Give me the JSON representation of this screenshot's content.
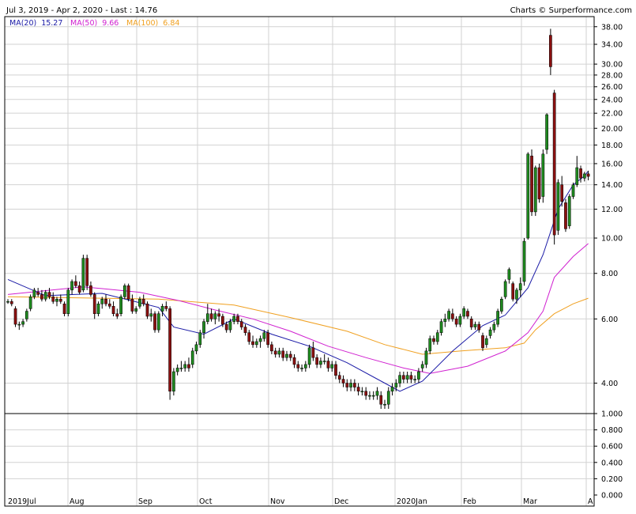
{
  "header": {
    "range_text": "Jul 3, 2019 - Apr 2, 2020 - Last : 14.76",
    "credit": "Charts © Surperformance.com"
  },
  "legend": [
    {
      "name": "MA(20)",
      "value": "15.27",
      "color": "#1a1aa6"
    },
    {
      "name": "MA(50)",
      "value": "9.66",
      "color": "#d020d0"
    },
    {
      "name": "MA(100)",
      "value": "6.84",
      "color": "#f0a020"
    }
  ],
  "colors": {
    "up": "#1f8a1f",
    "down": "#8b1010",
    "grid": "#d2d2d2",
    "frame": "#000000"
  },
  "chart_data": {
    "type": "candlestick",
    "scale": "log",
    "ylim": [
      3.3,
      40.5
    ],
    "y_ticks": [
      "4.00",
      "6.00",
      "8.00",
      "10.00",
      "12.00",
      "14.00",
      "16.00",
      "18.00",
      "20.00",
      "22.00",
      "24.00",
      "26.00",
      "28.00",
      "30.00",
      "34.00",
      "38.00"
    ],
    "x_ticks": [
      "2019Jul",
      "Aug",
      "Sep",
      "Oct",
      "Nov",
      "Dec",
      "2020Jan",
      "Feb",
      "Mar",
      "A"
    ],
    "candles": [
      [
        6.7,
        6.8,
        6.6,
        6.7
      ],
      [
        6.7,
        6.8,
        6.5,
        6.6
      ],
      [
        6.4,
        6.5,
        5.7,
        5.8
      ],
      [
        5.8,
        5.9,
        5.6,
        5.8
      ],
      [
        5.8,
        6.0,
        5.7,
        5.9
      ],
      [
        6.0,
        6.4,
        5.9,
        6.3
      ],
      [
        6.4,
        7.0,
        6.3,
        6.9
      ],
      [
        6.9,
        7.3,
        6.8,
        7.2
      ],
      [
        7.1,
        7.3,
        6.9,
        7.0
      ],
      [
        7.0,
        7.2,
        6.7,
        6.8
      ],
      [
        6.8,
        7.2,
        6.7,
        7.1
      ],
      [
        7.1,
        7.3,
        6.8,
        6.9
      ],
      [
        6.9,
        7.1,
        6.6,
        6.7
      ],
      [
        6.7,
        6.9,
        6.5,
        6.8
      ],
      [
        6.8,
        7.0,
        6.6,
        6.7
      ],
      [
        6.6,
        6.7,
        6.1,
        6.2
      ],
      [
        6.2,
        7.3,
        6.1,
        7.2
      ],
      [
        7.2,
        7.7,
        7.0,
        7.6
      ],
      [
        7.6,
        7.9,
        7.3,
        7.4
      ],
      [
        7.4,
        7.6,
        7.0,
        7.1
      ],
      [
        7.2,
        9.0,
        7.1,
        8.8
      ],
      [
        8.8,
        9.0,
        7.2,
        7.4
      ],
      [
        7.4,
        7.6,
        6.9,
        7.0
      ],
      [
        7.0,
        7.1,
        6.0,
        6.2
      ],
      [
        6.2,
        6.7,
        6.1,
        6.6
      ],
      [
        6.6,
        6.9,
        6.4,
        6.8
      ],
      [
        6.8,
        7.0,
        6.5,
        6.6
      ],
      [
        6.6,
        6.8,
        6.4,
        6.5
      ],
      [
        6.5,
        6.7,
        6.1,
        6.2
      ],
      [
        6.2,
        6.4,
        6.0,
        6.1
      ],
      [
        6.2,
        7.0,
        6.1,
        6.9
      ],
      [
        6.9,
        7.5,
        6.8,
        7.4
      ],
      [
        7.4,
        7.5,
        6.7,
        6.8
      ],
      [
        6.8,
        7.0,
        6.2,
        6.3
      ],
      [
        6.3,
        6.5,
        6.2,
        6.4
      ],
      [
        6.5,
        6.9,
        6.4,
        6.8
      ],
      [
        6.8,
        7.0,
        6.5,
        6.6
      ],
      [
        6.6,
        6.7,
        6.0,
        6.1
      ],
      [
        6.1,
        6.4,
        5.9,
        6.2
      ],
      [
        6.2,
        6.3,
        5.5,
        5.6
      ],
      [
        5.6,
        6.3,
        5.5,
        6.2
      ],
      [
        6.3,
        6.6,
        6.1,
        6.5
      ],
      [
        6.5,
        6.7,
        6.3,
        6.4
      ],
      [
        6.4,
        6.5,
        3.6,
        3.8
      ],
      [
        3.8,
        4.4,
        3.7,
        4.3
      ],
      [
        4.3,
        4.5,
        4.2,
        4.4
      ],
      [
        4.4,
        4.6,
        4.3,
        4.4
      ],
      [
        4.4,
        4.6,
        4.3,
        4.5
      ],
      [
        4.5,
        4.7,
        4.3,
        4.4
      ],
      [
        4.5,
        5.0,
        4.4,
        4.9
      ],
      [
        4.9,
        5.2,
        4.8,
        5.1
      ],
      [
        5.1,
        5.6,
        5.0,
        5.5
      ],
      [
        5.5,
        6.0,
        5.3,
        5.9
      ],
      [
        5.9,
        6.6,
        5.8,
        6.2
      ],
      [
        6.2,
        6.4,
        5.9,
        6.0
      ],
      [
        6.0,
        6.3,
        5.8,
        6.2
      ],
      [
        6.2,
        6.4,
        5.9,
        6.1
      ],
      [
        6.1,
        6.2,
        5.7,
        5.8
      ],
      [
        5.8,
        5.9,
        5.5,
        5.6
      ],
      [
        5.6,
        6.0,
        5.5,
        5.9
      ],
      [
        5.9,
        6.2,
        5.8,
        6.1
      ],
      [
        6.1,
        6.2,
        5.8,
        5.9
      ],
      [
        5.9,
        6.0,
        5.6,
        5.7
      ],
      [
        5.7,
        5.8,
        5.4,
        5.5
      ],
      [
        5.5,
        5.6,
        5.1,
        5.2
      ],
      [
        5.2,
        5.4,
        5.0,
        5.1
      ],
      [
        5.1,
        5.3,
        5.0,
        5.2
      ],
      [
        5.2,
        5.4,
        5.0,
        5.3
      ],
      [
        5.3,
        5.6,
        5.2,
        5.5
      ],
      [
        5.5,
        5.6,
        5.0,
        5.1
      ],
      [
        5.1,
        5.2,
        4.8,
        4.9
      ],
      [
        4.9,
        5.0,
        4.7,
        4.8
      ],
      [
        4.8,
        5.0,
        4.7,
        4.9
      ],
      [
        4.9,
        5.0,
        4.6,
        4.7
      ],
      [
        4.7,
        4.9,
        4.6,
        4.8
      ],
      [
        4.8,
        4.9,
        4.6,
        4.7
      ],
      [
        4.7,
        4.8,
        4.4,
        4.5
      ],
      [
        4.5,
        4.6,
        4.3,
        4.4
      ],
      [
        4.4,
        4.5,
        4.3,
        4.4
      ],
      [
        4.4,
        4.6,
        4.3,
        4.5
      ],
      [
        4.5,
        5.1,
        4.4,
        5.0
      ],
      [
        5.0,
        5.2,
        4.6,
        4.7
      ],
      [
        4.7,
        4.8,
        4.4,
        4.5
      ],
      [
        4.5,
        4.7,
        4.4,
        4.6
      ],
      [
        4.6,
        4.8,
        4.5,
        4.6
      ],
      [
        4.6,
        4.7,
        4.3,
        4.4
      ],
      [
        4.4,
        4.6,
        4.3,
        4.5
      ],
      [
        4.5,
        4.6,
        4.1,
        4.2
      ],
      [
        4.2,
        4.3,
        4.0,
        4.1
      ],
      [
        4.1,
        4.2,
        3.9,
        4.0
      ],
      [
        4.0,
        4.1,
        3.8,
        3.9
      ],
      [
        3.9,
        4.1,
        3.8,
        4.0
      ],
      [
        4.0,
        4.1,
        3.8,
        3.9
      ],
      [
        3.9,
        4.0,
        3.7,
        3.8
      ],
      [
        3.8,
        3.9,
        3.7,
        3.8
      ],
      [
        3.8,
        3.9,
        3.6,
        3.7
      ],
      [
        3.7,
        3.8,
        3.6,
        3.7
      ],
      [
        3.7,
        3.8,
        3.6,
        3.7
      ],
      [
        3.7,
        3.9,
        3.6,
        3.8
      ],
      [
        3.7,
        3.8,
        3.4,
        3.5
      ],
      [
        3.5,
        3.6,
        3.4,
        3.5
      ],
      [
        3.5,
        3.9,
        3.4,
        3.8
      ],
      [
        3.8,
        4.0,
        3.7,
        3.9
      ],
      [
        3.9,
        4.1,
        3.8,
        4.0
      ],
      [
        4.0,
        4.3,
        3.9,
        4.2
      ],
      [
        4.2,
        4.3,
        4.0,
        4.1
      ],
      [
        4.1,
        4.3,
        4.0,
        4.2
      ],
      [
        4.2,
        4.3,
        4.0,
        4.1
      ],
      [
        4.1,
        4.2,
        4.0,
        4.1
      ],
      [
        4.1,
        4.4,
        4.0,
        4.3
      ],
      [
        4.4,
        4.6,
        4.3,
        4.5
      ],
      [
        4.5,
        5.0,
        4.4,
        4.9
      ],
      [
        4.9,
        5.4,
        4.8,
        5.3
      ],
      [
        5.3,
        5.4,
        5.1,
        5.2
      ],
      [
        5.2,
        5.6,
        5.1,
        5.5
      ],
      [
        5.5,
        6.0,
        5.4,
        5.9
      ],
      [
        5.9,
        6.2,
        5.7,
        6.0
      ],
      [
        6.0,
        6.4,
        5.9,
        6.3
      ],
      [
        6.2,
        6.4,
        5.9,
        6.0
      ],
      [
        6.0,
        6.1,
        5.7,
        5.8
      ],
      [
        5.8,
        6.2,
        5.7,
        6.1
      ],
      [
        6.1,
        6.5,
        6.0,
        6.4
      ],
      [
        6.3,
        6.4,
        6.0,
        6.1
      ],
      [
        6.0,
        6.1,
        5.6,
        5.7
      ],
      [
        5.7,
        5.9,
        5.6,
        5.8
      ],
      [
        5.8,
        5.9,
        5.5,
        5.6
      ],
      [
        5.4,
        5.5,
        4.9,
        5.0
      ],
      [
        5.1,
        5.4,
        5.0,
        5.3
      ],
      [
        5.4,
        5.7,
        5.3,
        5.6
      ],
      [
        5.6,
        5.9,
        5.5,
        5.8
      ],
      [
        5.8,
        6.4,
        5.7,
        6.3
      ],
      [
        6.3,
        6.9,
        6.2,
        6.8
      ],
      [
        6.9,
        7.7,
        6.8,
        7.6
      ],
      [
        7.7,
        8.3,
        7.5,
        8.2
      ],
      [
        7.5,
        7.6,
        6.7,
        6.8
      ],
      [
        6.8,
        7.3,
        6.6,
        7.2
      ],
      [
        7.2,
        7.8,
        6.9,
        7.5
      ],
      [
        7.6,
        10.0,
        7.4,
        9.8
      ],
      [
        10.0,
        17.2,
        9.9,
        17.0
      ],
      [
        16.8,
        17.5,
        11.5,
        11.8
      ],
      [
        11.8,
        15.8,
        11.5,
        15.6
      ],
      [
        15.6,
        16.0,
        12.5,
        12.8
      ],
      [
        13.0,
        17.5,
        12.5,
        17.0
      ],
      [
        17.5,
        22.0,
        17.0,
        21.8
      ],
      [
        36.0,
        37.5,
        28.0,
        29.5
      ],
      [
        25.0,
        25.5,
        9.6,
        10.2
      ],
      [
        10.5,
        14.5,
        10.2,
        14.2
      ],
      [
        14.0,
        14.8,
        12.2,
        12.6
      ],
      [
        12.5,
        12.8,
        10.4,
        10.6
      ],
      [
        10.8,
        13.2,
        10.6,
        13.0
      ],
      [
        13.0,
        14.2,
        12.8,
        14.0
      ],
      [
        14.0,
        16.8,
        13.8,
        15.6
      ],
      [
        15.5,
        15.8,
        14.2,
        14.6
      ],
      [
        14.6,
        15.2,
        14.3,
        15.0
      ],
      [
        15.0,
        15.3,
        14.4,
        14.76
      ]
    ],
    "ma20": [
      [
        0,
        7.7
      ],
      [
        10,
        6.95
      ],
      [
        25,
        7.05
      ],
      [
        40,
        6.45
      ],
      [
        44,
        5.7
      ],
      [
        52,
        5.45
      ],
      [
        60,
        6.0
      ],
      [
        70,
        5.45
      ],
      [
        80,
        5.05
      ],
      [
        90,
        4.55
      ],
      [
        100,
        4.0
      ],
      [
        104,
        3.8
      ],
      [
        110,
        4.05
      ],
      [
        118,
        4.9
      ],
      [
        126,
        5.75
      ],
      [
        132,
        6.15
      ],
      [
        138,
        7.3
      ],
      [
        142,
        9.0
      ],
      [
        146,
        12.0
      ],
      [
        150,
        14.0
      ],
      [
        153,
        14.8
      ],
      [
        154,
        15.27
      ]
    ],
    "ma50": [
      [
        0,
        7.0
      ],
      [
        20,
        7.35
      ],
      [
        35,
        7.1
      ],
      [
        45,
        6.75
      ],
      [
        55,
        6.35
      ],
      [
        65,
        6.0
      ],
      [
        75,
        5.55
      ],
      [
        85,
        5.05
      ],
      [
        95,
        4.7
      ],
      [
        105,
        4.4
      ],
      [
        112,
        4.25
      ],
      [
        122,
        4.45
      ],
      [
        132,
        4.9
      ],
      [
        138,
        5.5
      ],
      [
        142,
        6.3
      ],
      [
        145,
        7.8
      ],
      [
        150,
        8.9
      ],
      [
        154,
        9.66
      ]
    ],
    "ma100": [
      [
        0,
        6.9
      ],
      [
        40,
        6.8
      ],
      [
        60,
        6.55
      ],
      [
        75,
        6.05
      ],
      [
        90,
        5.55
      ],
      [
        100,
        5.1
      ],
      [
        110,
        4.8
      ],
      [
        120,
        4.9
      ],
      [
        132,
        5.0
      ],
      [
        137,
        5.15
      ],
      [
        140,
        5.6
      ],
      [
        145,
        6.2
      ],
      [
        150,
        6.6
      ],
      [
        154,
        6.84
      ]
    ],
    "lower_panel": {
      "ylim": [
        0,
        1.0
      ],
      "y_ticks": [
        "0.000",
        "0.200",
        "0.400",
        "0.600",
        "0.800",
        "1.000"
      ]
    }
  }
}
